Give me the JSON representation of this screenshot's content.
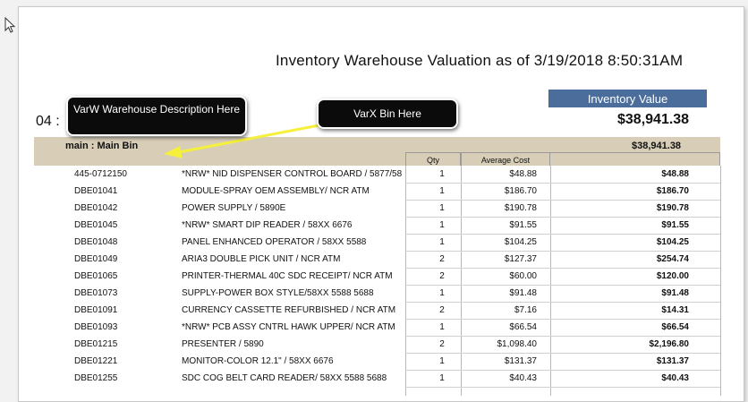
{
  "report": {
    "title": "Inventory Warehouse Valuation as of 3/19/2018  8:50:31AM",
    "inventory_value_label": "Inventory Value",
    "inventory_total": "$38,941.38",
    "warehouse_code": "04 :",
    "bin_name": "main : Main Bin",
    "bin_total": "$38,941.38",
    "columns": {
      "qty": "Qty",
      "average_cost": "Average Cost"
    },
    "rows": [
      {
        "code": "445-0712150",
        "description": "*NRW* NID DISPENSER CONTROL BOARD / 5877/58",
        "qty": "1",
        "avg_cost": "$48.88",
        "value": "$48.88"
      },
      {
        "code": "DBE01041",
        "description": "MODULE-SPRAY OEM ASSEMBLY/ NCR ATM",
        "qty": "1",
        "avg_cost": "$186.70",
        "value": "$186.70"
      },
      {
        "code": "DBE01042",
        "description": "POWER SUPPLY / 5890E",
        "qty": "1",
        "avg_cost": "$190.78",
        "value": "$190.78"
      },
      {
        "code": "DBE01045",
        "description": "*NRW* SMART DIP READER / 58XX 6676",
        "qty": "1",
        "avg_cost": "$91.55",
        "value": "$91.55"
      },
      {
        "code": "DBE01048",
        "description": "PANEL ENHANCED OPERATOR / 58XX 5588",
        "qty": "1",
        "avg_cost": "$104.25",
        "value": "$104.25"
      },
      {
        "code": "DBE01049",
        "description": "ARIA3 DOUBLE PICK UNIT / NCR ATM",
        "qty": "2",
        "avg_cost": "$127.37",
        "value": "$254.74"
      },
      {
        "code": "DBE01065",
        "description": "PRINTER-THERMAL 40C SDC RECEIPT/ NCR ATM",
        "qty": "2",
        "avg_cost": "$60.00",
        "value": "$120.00"
      },
      {
        "code": "DBE01073",
        "description": "SUPPLY-POWER BOX STYLE/58XX 5588 5688",
        "qty": "1",
        "avg_cost": "$91.48",
        "value": "$91.48"
      },
      {
        "code": "DBE01091",
        "description": "CURRENCY CASSETTE REFURBISHED / NCR ATM",
        "qty": "2",
        "avg_cost": "$7.16",
        "value": "$14.31"
      },
      {
        "code": "DBE01093",
        "description": "*NRW* PCB ASSY CNTRL HAWK UPPER/ NCR ATM",
        "qty": "1",
        "avg_cost": "$66.54",
        "value": "$66.54"
      },
      {
        "code": "DBE01215",
        "description": "PRESENTER  / 5890",
        "qty": "2",
        "avg_cost": "$1,098.40",
        "value": "$2,196.80"
      },
      {
        "code": "DBE01221",
        "description": "MONITOR-COLOR 12.1\" / 58XX 6676",
        "qty": "1",
        "avg_cost": "$131.37",
        "value": "$131.37"
      },
      {
        "code": "DBE01255",
        "description": "SDC COG BELT CARD READER/ 58XX 5588 5688",
        "qty": "1",
        "avg_cost": "$40.43",
        "value": "$40.43"
      }
    ]
  },
  "annotations": {
    "warehouse_callout": "VarW Warehouse Description Here",
    "bin_callout": "VarX Bin Here",
    "arrow_color": "#f5f03c"
  }
}
